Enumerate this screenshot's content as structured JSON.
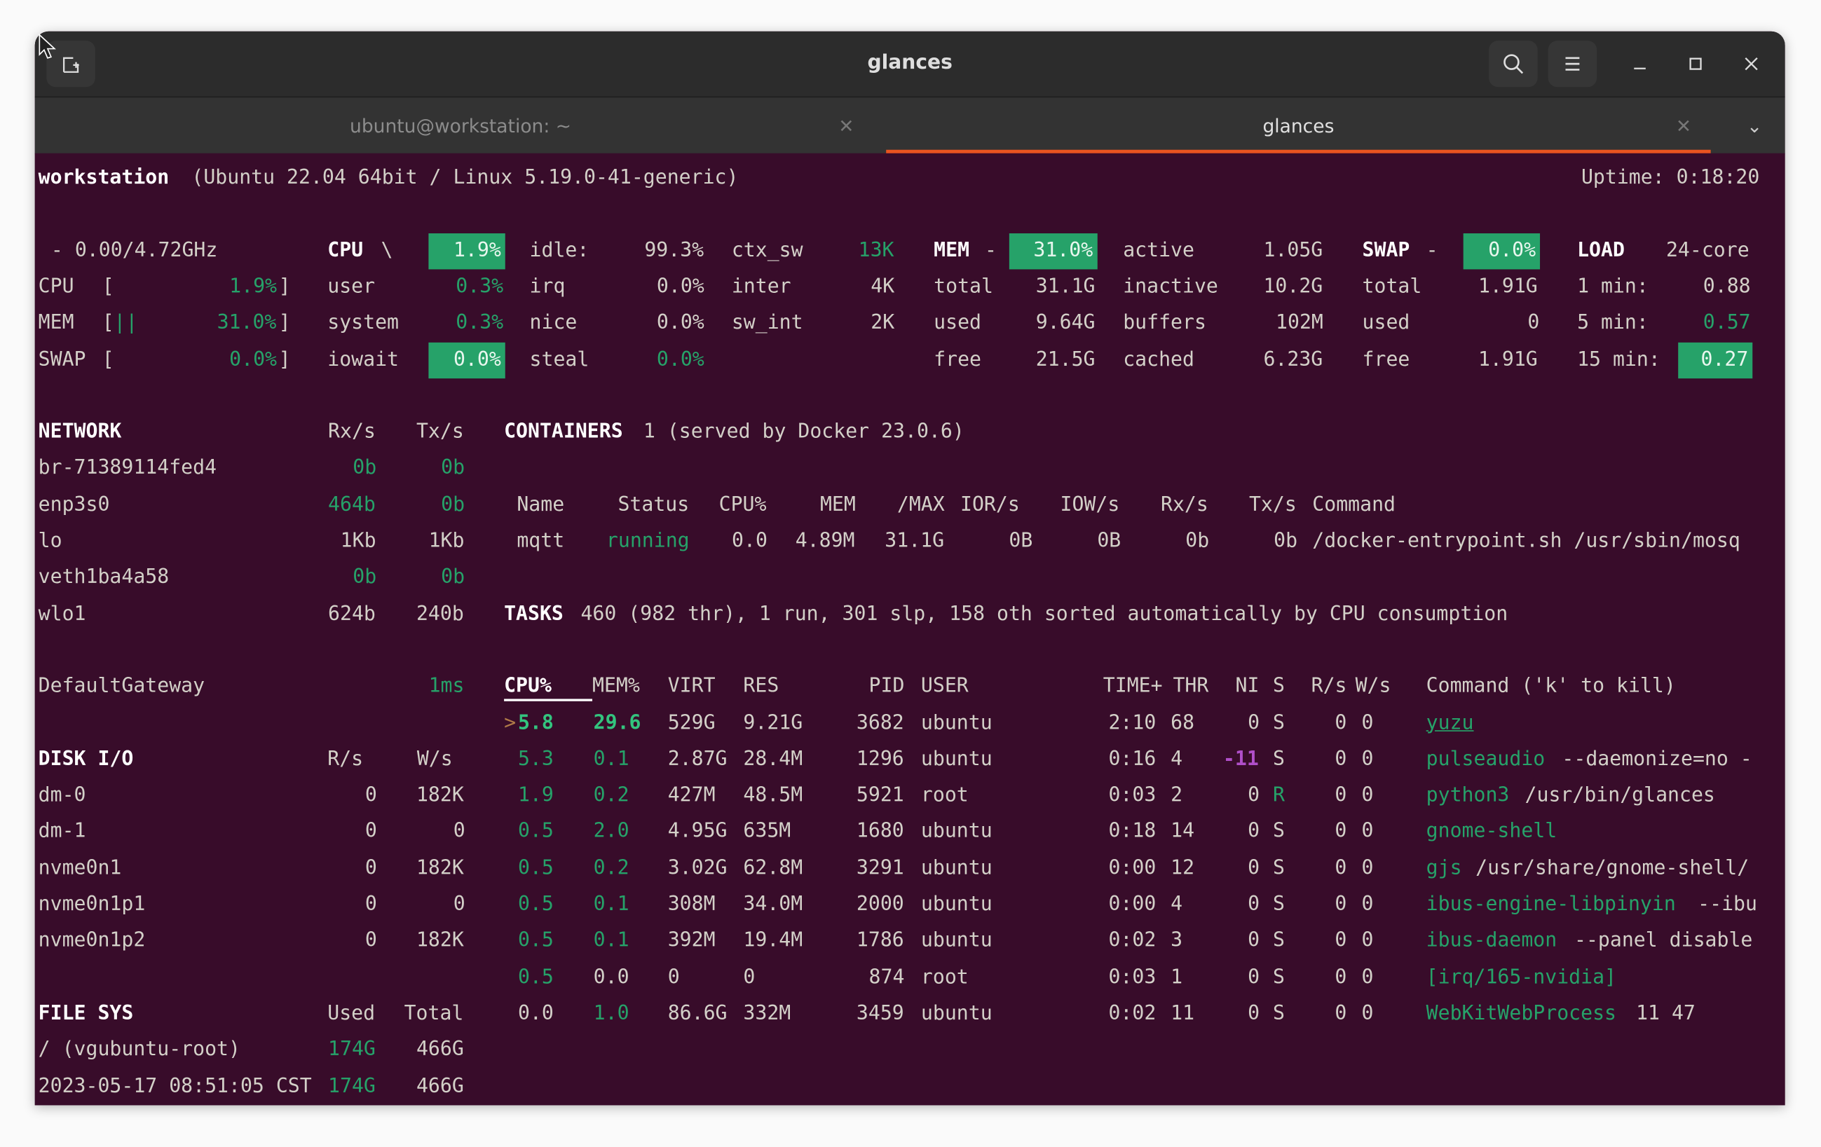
{
  "window": {
    "title": "glances",
    "tabs": [
      {
        "label": "ubuntu@workstation: ~",
        "active": false
      },
      {
        "label": "glances",
        "active": true
      }
    ],
    "accent_color": "#e95420",
    "terminal_bg": "#380c2a"
  },
  "header": {
    "hostname": "workstation",
    "system": "(Ubuntu 22.04 64bit / Linux 5.19.0-41-generic)",
    "uptime": "Uptime: 0:18:20"
  },
  "quicklook": {
    "freq": "- 0.00/4.72GHz",
    "bars": [
      {
        "label": "CPU",
        "bar": "",
        "value": "1.9%"
      },
      {
        "label": "MEM",
        "bar": "||",
        "value": "31.0%"
      },
      {
        "label": "SWAP",
        "bar": "",
        "value": "0.0%"
      }
    ]
  },
  "cpu": {
    "title": "CPU",
    "spinner": "\\",
    "total": "1.9%",
    "col1": [
      [
        "user",
        "0.3%"
      ],
      [
        "system",
        "0.3%"
      ],
      [
        "iowait",
        "0.0%"
      ]
    ],
    "col2": [
      [
        "idle:",
        "99.3%"
      ],
      [
        "irq",
        "0.0%"
      ],
      [
        "nice",
        "0.0%"
      ],
      [
        "steal",
        "0.0%"
      ]
    ],
    "col3": [
      [
        "ctx_sw",
        "13K"
      ],
      [
        "inter",
        "4K"
      ],
      [
        "sw_int",
        "2K"
      ]
    ]
  },
  "mem": {
    "title": "MEM",
    "dash": "-",
    "total": "31.0%",
    "col1": [
      [
        "total",
        "31.1G"
      ],
      [
        "used",
        "9.64G"
      ],
      [
        "free",
        "21.5G"
      ]
    ],
    "col2": [
      [
        "active",
        "1.05G"
      ],
      [
        "inactive",
        "10.2G"
      ],
      [
        "buffers",
        "102M"
      ],
      [
        "cached",
        "6.23G"
      ]
    ]
  },
  "swap": {
    "title": "SWAP",
    "dash": "-",
    "total": "0.0%",
    "col1": [
      [
        "total",
        "1.91G"
      ],
      [
        "used",
        "0"
      ],
      [
        "free",
        "1.91G"
      ]
    ]
  },
  "load": {
    "title": "LOAD",
    "cores": "24-core",
    "rows": [
      [
        "1 min:",
        "0.88"
      ],
      [
        "5 min:",
        "0.57"
      ],
      [
        "15 min:",
        "0.27"
      ]
    ]
  },
  "network": {
    "title": "NETWORK",
    "rx_header": "Rx/s",
    "tx_header": "Tx/s",
    "rows": [
      {
        "name": "br-71389114fed4",
        "rx": "0b",
        "tx": "0b",
        "level": "ok"
      },
      {
        "name": "enp3s0",
        "rx": "464b",
        "tx": "0b",
        "level": "ok"
      },
      {
        "name": "lo",
        "rx": "1Kb",
        "tx": "1Kb",
        "level": "default"
      },
      {
        "name": "veth1ba4a58",
        "rx": "0b",
        "tx": "0b",
        "level": "ok"
      },
      {
        "name": "wlo1",
        "rx": "624b",
        "tx": "240b",
        "level": "default"
      }
    ],
    "gateway": {
      "name": "DefaultGateway",
      "value": "1ms"
    }
  },
  "disk": {
    "title": "DISK I/O",
    "r_header": "R/s",
    "w_header": "W/s",
    "rows": [
      {
        "name": "dm-0",
        "r": "0",
        "w": "182K"
      },
      {
        "name": "dm-1",
        "r": "0",
        "w": "0"
      },
      {
        "name": "nvme0n1",
        "r": "0",
        "w": "182K"
      },
      {
        "name": "nvme0n1p1",
        "r": "0",
        "w": "0"
      },
      {
        "name": "nvme0n1p2",
        "r": "0",
        "w": "182K"
      }
    ]
  },
  "filesys": {
    "title": "FILE SYS",
    "used_header": "Used",
    "total_header": "Total",
    "rows": [
      {
        "name": "/ (vgubuntu-root)",
        "used": "174G",
        "total": "466G"
      },
      {
        "name": "2023-05-17 08:51:05 CST",
        "used": "174G",
        "total": "466G"
      }
    ]
  },
  "containers": {
    "title": "CONTAINERS",
    "summary": "1 (served by Docker 23.0.6)",
    "headers": [
      "Name",
      "Status",
      "CPU%",
      "MEM",
      "/MAX",
      "IOR/s",
      "IOW/s",
      "Rx/s",
      "Tx/s",
      "Command"
    ],
    "rows": [
      [
        "mqtt",
        "running",
        "0.0",
        "4.89M",
        "31.1G",
        "0B",
        "0B",
        "0b",
        "0b",
        "/docker-entrypoint.sh /usr/sbin/mosq"
      ]
    ]
  },
  "tasks": {
    "title": "TASKS",
    "summary": "460 (982 thr), 1 run, 301 slp, 158 oth sorted automatically by CPU consumption"
  },
  "processes": {
    "headers": [
      "CPU%",
      "MEM%",
      "VIRT",
      "RES",
      "PID",
      "USER",
      "TIME+",
      "THR",
      "NI",
      "S",
      "R/s",
      "W/s",
      "Command ('k' to kill)"
    ],
    "sort_column": "CPU%",
    "selected_marker": ">",
    "rows": [
      {
        "cpu": "5.8",
        "mem": "29.6",
        "virt": "529G",
        "res": "9.21G",
        "pid": "3682",
        "user": "ubuntu",
        "time": "2:10",
        "thr": "68",
        "ni": "0",
        "s": "S",
        "rs": "0",
        "ws": "0",
        "cmd": "yuzu",
        "args": "",
        "cpu_level": "ok",
        "mem_level": "ok-bold",
        "selected": true
      },
      {
        "cpu": "5.3",
        "mem": "0.1",
        "virt": "2.87G",
        "res": "28.4M",
        "pid": "1296",
        "user": "ubuntu",
        "time": "0:16",
        "thr": "4",
        "ni": "-11",
        "s": "S",
        "rs": "0",
        "ws": "0",
        "cmd": "pulseaudio",
        "args": "--daemonize=no -",
        "cpu_level": "ok",
        "mem_level": "ok"
      },
      {
        "cpu": "1.9",
        "mem": "0.2",
        "virt": "427M",
        "res": "48.5M",
        "pid": "5921",
        "user": "root",
        "time": "0:03",
        "thr": "2",
        "ni": "0",
        "s": "R",
        "rs": "0",
        "ws": "0",
        "cmd": "python3",
        "args": "/usr/bin/glances",
        "cpu_level": "ok",
        "mem_level": "ok"
      },
      {
        "cpu": "0.5",
        "mem": "2.0",
        "virt": "4.95G",
        "res": "635M",
        "pid": "1680",
        "user": "ubuntu",
        "time": "0:18",
        "thr": "14",
        "ni": "0",
        "s": "S",
        "rs": "0",
        "ws": "0",
        "cmd": "gnome-shell",
        "args": "",
        "cpu_level": "ok",
        "mem_level": "ok"
      },
      {
        "cpu": "0.5",
        "mem": "0.2",
        "virt": "3.02G",
        "res": "62.8M",
        "pid": "3291",
        "user": "ubuntu",
        "time": "0:00",
        "thr": "12",
        "ni": "0",
        "s": "S",
        "rs": "0",
        "ws": "0",
        "cmd": "gjs",
        "args": "/usr/share/gnome-shell/",
        "cpu_level": "ok",
        "mem_level": "ok"
      },
      {
        "cpu": "0.5",
        "mem": "0.1",
        "virt": "308M",
        "res": "34.0M",
        "pid": "2000",
        "user": "ubuntu",
        "time": "0:00",
        "thr": "4",
        "ni": "0",
        "s": "S",
        "rs": "0",
        "ws": "0",
        "cmd": "ibus-engine-libpinyin",
        "args": "--ibu",
        "cpu_level": "ok",
        "mem_level": "ok"
      },
      {
        "cpu": "0.5",
        "mem": "0.1",
        "virt": "392M",
        "res": "19.4M",
        "pid": "1786",
        "user": "ubuntu",
        "time": "0:02",
        "thr": "3",
        "ni": "0",
        "s": "S",
        "rs": "0",
        "ws": "0",
        "cmd": "ibus-daemon",
        "args": "--panel disable",
        "cpu_level": "ok",
        "mem_level": "ok"
      },
      {
        "cpu": "0.5",
        "mem": "0.0",
        "virt": "0",
        "res": "0",
        "pid": "874",
        "user": "root",
        "time": "0:03",
        "thr": "1",
        "ni": "0",
        "s": "S",
        "rs": "0",
        "ws": "0",
        "cmd": "[irq/165-nvidia]",
        "args": "",
        "cpu_level": "ok",
        "mem_level": "default"
      },
      {
        "cpu": "0.0",
        "mem": "1.0",
        "virt": "86.6G",
        "res": "332M",
        "pid": "3459",
        "user": "ubuntu",
        "time": "0:02",
        "thr": "11",
        "ni": "0",
        "s": "S",
        "rs": "0",
        "ws": "0",
        "cmd": "WebKitWebProcess",
        "args": "11 47",
        "cpu_level": "default",
        "mem_level": "ok"
      }
    ]
  }
}
